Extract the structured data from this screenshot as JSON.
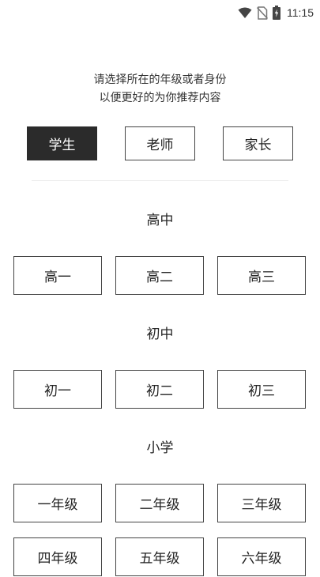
{
  "status_bar": {
    "time": "11:15",
    "icons": [
      "wifi-icon",
      "no-sim-icon",
      "battery-charging-icon"
    ]
  },
  "prompt": {
    "line1": "请选择所在的年级或者身份",
    "line2": "以便更好的为你推荐内容"
  },
  "roles": {
    "selected": "学生",
    "items": [
      {
        "label": "学生",
        "selected": true
      },
      {
        "label": "老师",
        "selected": false
      },
      {
        "label": "家长",
        "selected": false
      }
    ]
  },
  "sections": [
    {
      "title": "高中",
      "grades": [
        "高一",
        "高二",
        "高三"
      ]
    },
    {
      "title": "初中",
      "grades": [
        "初一",
        "初二",
        "初三"
      ]
    },
    {
      "title": "小学",
      "grades": [
        "一年级",
        "二年级",
        "三年级",
        "四年级",
        "五年级",
        "六年级"
      ]
    }
  ]
}
